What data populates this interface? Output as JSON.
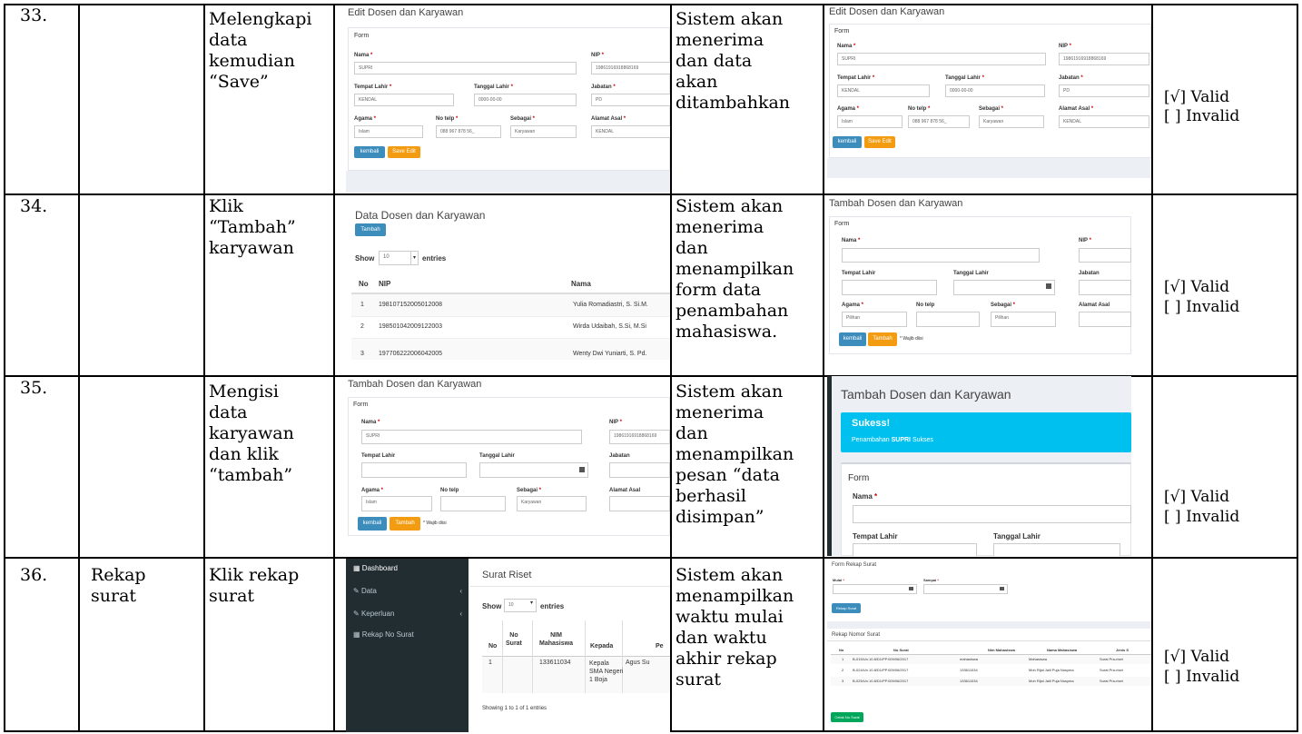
{
  "rows": [
    {
      "no": "33.",
      "feature": "",
      "scenario": "Melengkapi\ndata\nkemudian\n“Save”",
      "expected": "Sistem akan\nmenerima\ndan data\nakan\nditambahkan",
      "valid": "[√] Valid",
      "invalid": "[  ] Invalid"
    },
    {
      "no": "34.",
      "feature": "",
      "scenario": "Klik\n“Tambah”\nkaryawan",
      "expected": "Sistem akan\nmenerima\ndan\nmenampilkan\nform data\npenambahan\nmahasiswa.",
      "valid": "[√] Valid",
      "invalid": "[  ] Invalid"
    },
    {
      "no": "35.",
      "feature": "",
      "scenario": "Mengisi\ndata\nkaryawan\ndan klik\n“tambah”",
      "expected": "Sistem akan\nmenerima\ndan\nmenampilkan\npesan “data\nberhasil\ndisimpan”",
      "valid": "[√] Valid",
      "invalid": "[  ] Invalid"
    },
    {
      "no": "36.",
      "feature": "Rekap\nsurat",
      "scenario": "Klik rekap\nsurat",
      "expected": "Sistem akan\nmenampilkan\nwaktu mulai\ndan waktu\nakhir rekap\nsurat",
      "valid": "[√] Valid",
      "invalid": "[  ] Invalid"
    }
  ],
  "edit_form": {
    "title": "Edit Dosen dan Karyawan",
    "form": "Form",
    "nama_label": "Nama",
    "nama": "SUPRI",
    "nip_label": "NIP",
    "nip": "19861916918868169",
    "tempat_label": "Tempat Lahir",
    "tempat": "KENDAL",
    "tanggal_label": "Tanggal Lahir",
    "tanggal": "0000-00-00",
    "jabatan_label": "Jabatan",
    "jabatan": "PD",
    "agama_label": "Agama",
    "agama": "Islam",
    "telp_label": "No telp",
    "telp": "088 967 878 56_",
    "sebagai_label": "Sebagai",
    "sebagai": "Karyawan",
    "alamat_label": "Alamat Asal",
    "alamat": "KENDAL",
    "kembali": "kembali",
    "save": "Save Edit"
  },
  "data_list": {
    "title": "Data Dosen dan Karyawan",
    "tambah": "Tambah",
    "show": "Show",
    "entries_value": "10",
    "entries": "entries",
    "col_no": "No",
    "col_nip": "NIP",
    "col_nama": "Nama",
    "rows": [
      {
        "no": "1",
        "nip": "198107152005012008",
        "nama": "Yulia Romadiastri, S. Si.M."
      },
      {
        "no": "2",
        "nip": "198501042009122003",
        "nama": "Wirda Udaibah, S.Si, M.Si"
      },
      {
        "no": "3",
        "nip": "197706222006042005",
        "nama": "Wenty Dwi Yuniarti, S. Pd."
      }
    ]
  },
  "tambah_form": {
    "title": "Tambah Dosen dan Karyawan",
    "form": "Form",
    "nama_label": "Nama",
    "nip_label": "NIP",
    "tempat_label": "Tempat Lahir",
    "tanggal_label": "Tanggal Lahir",
    "jabatan_label": "Jabatan",
    "agama_label": "Agama",
    "telp_label": "No telp",
    "sebagai_label": "Sebagai",
    "alamat_label": "Alamat Asal",
    "pilihan": "Pilihan",
    "kembali": "kembali",
    "tambah": "Tambah",
    "wajib": "* Wajib diisi",
    "filled_nama": "SUPRI",
    "filled_nip": "19861916918868169",
    "filled_agama": "Islam",
    "filled_sebagai": "Karyawan"
  },
  "sukses": {
    "title": "Tambah Dosen dan Karyawan",
    "heading": "Sukess!",
    "msg_pre": "Penambahan ",
    "msg_name": "SUPRI",
    "msg_post": " Sukses",
    "form": "Form",
    "nama_label": "Nama",
    "tempat_label": "Tempat Lahir",
    "tanggal_label": "Tanggal Lahir"
  },
  "sidebar": {
    "items": [
      "Dashboard",
      "Data",
      "Keperluan",
      "Rekap No Surat"
    ]
  },
  "riset": {
    "title": "Surat Riset",
    "show": "Show",
    "entries_value": "10",
    "entries": "entries",
    "col_no": "No",
    "col_nosurat": "No\nSurat",
    "col_nim": "NIM\nMahasiswa",
    "col_kepada": "Kepada",
    "col_pe": "Pe",
    "row_no": "1",
    "row_nim": "133611034",
    "row_kepada": "Kepala\nSMA Negeri\n1 Boja",
    "row_pe": "Agus Su",
    "footer": "Showing 1 to 1 of 1 entries"
  },
  "rekap": {
    "title": "Form Rekap Surat",
    "mulai": "Mulai",
    "sampai": "Sampai",
    "btn": "Rekap Surat",
    "table_title": "Rekap Nomor Surat",
    "cols": [
      "No",
      "No Surat",
      "Nim Mahasiswa",
      "Nama Mahasiswa",
      "Jenis S"
    ],
    "rows": [
      [
        "1",
        "B-015/Un.10.8/D1/PP.009/06/2017",
        "mahasiswa",
        "Mahasiswa",
        "Surat Pra-riset"
      ],
      [
        "2",
        "B-024/Un.10.8/D1/PP.009/06/2017",
        "133611034",
        "Moh Rijal Jalil Puja Nusyma",
        "Surat Pra-riset"
      ],
      [
        "3",
        "B-025/Un.10.8/D1/PP.009/06/2017",
        "133611034",
        "Moh Rijal Jalil Puja Nusyma",
        "Surat Pra-riset"
      ]
    ],
    "cetak": "Cetak No Surat"
  }
}
